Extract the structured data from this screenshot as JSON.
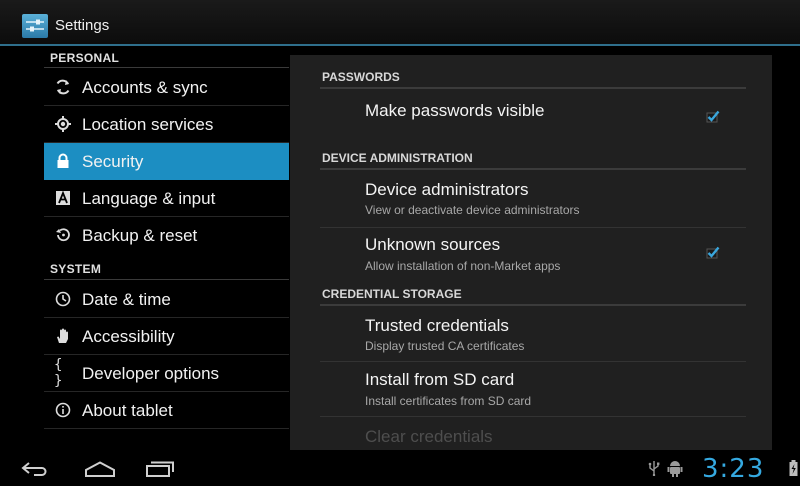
{
  "window": {
    "title": "Settings",
    "app_icon": "settings-sliders-icon"
  },
  "sidebar": {
    "sections": [
      {
        "header": "PERSONAL"
      },
      {
        "header": "SYSTEM"
      }
    ],
    "items": [
      {
        "label": "Accounts & sync",
        "icon": "sync-icon"
      },
      {
        "label": "Location services",
        "icon": "location-target-icon"
      },
      {
        "label": "Security",
        "icon": "lock-icon",
        "selected": true
      },
      {
        "label": "Language & input",
        "icon": "keyboard-a-icon"
      },
      {
        "label": "Backup & reset",
        "icon": "restore-icon"
      },
      {
        "label": "Date & time",
        "icon": "clock-icon"
      },
      {
        "label": "Accessibility",
        "icon": "hand-icon"
      },
      {
        "label": "Developer options",
        "icon": "braces-icon",
        "glyph": "{ }"
      },
      {
        "label": "About tablet",
        "icon": "info-icon"
      }
    ]
  },
  "main": {
    "categories": [
      {
        "title": "PASSWORDS"
      },
      {
        "title": "DEVICE ADMINISTRATION"
      },
      {
        "title": "CREDENTIAL STORAGE"
      }
    ],
    "prefs": [
      {
        "title": "Make passwords visible",
        "summary": "",
        "checkbox": true,
        "checked": true
      },
      {
        "title": "Device administrators",
        "summary": "View or deactivate device administrators",
        "checkbox": false
      },
      {
        "title": "Unknown sources",
        "summary": "Allow installation of non-Market apps",
        "checkbox": true,
        "checked": true
      },
      {
        "title": "Trusted credentials",
        "summary": "Display trusted CA certificates",
        "checkbox": false
      },
      {
        "title": "Install from SD card",
        "summary": "Install certificates from SD card",
        "checkbox": false
      },
      {
        "title": "Clear credentials",
        "summary": "",
        "checkbox": false,
        "disabled": true
      }
    ]
  },
  "statusbar": {
    "time": "3:23",
    "icons": [
      "back-icon",
      "home-icon",
      "recent-apps-icon",
      "usb-icon",
      "android-debug-icon",
      "battery-charging-icon"
    ]
  },
  "colors": {
    "accent": "#1c8ec2",
    "clock": "#35a9e0",
    "checkmark": "#3aa6dc",
    "background": "#000000",
    "panel": "#202020"
  }
}
